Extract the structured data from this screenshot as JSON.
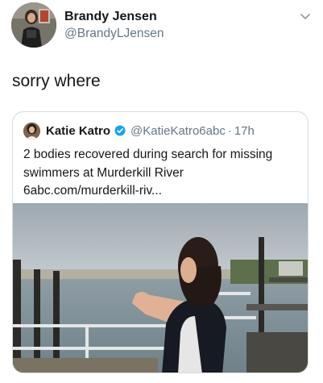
{
  "tweet": {
    "author": {
      "display_name": "Brandy Jensen",
      "handle": "@BrandyLJensen",
      "avatar_icon": "user-avatar-photo"
    },
    "menu_icon": "chevron-down-icon",
    "text": "sorry where"
  },
  "quoted_tweet": {
    "author": {
      "display_name": "Katie Katro",
      "handle": "@KatieKatro6abc",
      "verified": true,
      "verified_color": "#1da1f2",
      "avatar_icon": "user-avatar-photo"
    },
    "separator": "·",
    "time": "17h",
    "text": "2 bodies recovered during search for missing swimmers at Murderkill River 6abc.com/murderkill-riv...",
    "media": {
      "type": "video-thumbnail",
      "icon": "photo-woman-pointing-at-river"
    }
  },
  "colors": {
    "text_primary": "#14171a",
    "text_secondary": "#657786",
    "border": "#d5dce1",
    "accent": "#1da1f2"
  }
}
